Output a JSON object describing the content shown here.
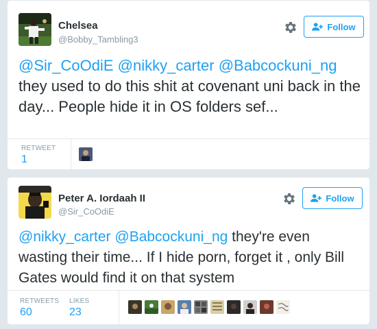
{
  "tweets": [
    {
      "name": "Chelsea",
      "handle": "@Bobby_Tambling3",
      "follow_label": "Follow",
      "text_mentions": [
        "@Sir_CoOdiE",
        "@nikky_carter",
        "@Babcockuni_ng"
      ],
      "text_body": " they used to do this shit at covenant uni back in the day... People hide it in OS folders sef...",
      "stats": {
        "retweet_label": "RETWEET",
        "retweet_count": "1"
      },
      "engager_avatars": [
        "retweeter-avatar"
      ]
    },
    {
      "name": "Peter A. Iordaah II",
      "handle": "@Sir_CoOdiE",
      "follow_label": "Follow",
      "text_mentions": [
        "@nikky_carter",
        "@Babcockuni_ng"
      ],
      "text_body": " they're even wasting their time... If I hide porn, forget it , only Bill Gates would find it on that system",
      "stats": {
        "retweets_label": "RETWEETS",
        "retweets_count": "60",
        "likes_label": "LIKES",
        "likes_count": "23"
      },
      "engager_avatars": [
        "liker-avatar-1",
        "liker-avatar-2",
        "liker-avatar-3",
        "liker-avatar-4",
        "liker-avatar-5",
        "liker-avatar-6",
        "liker-avatar-7",
        "liker-avatar-8",
        "liker-avatar-9",
        "liker-avatar-10"
      ]
    }
  ],
  "colors": {
    "link": "#1da1f2",
    "muted": "#8899a6",
    "text": "#292f33",
    "border": "#e1e8ed"
  },
  "icons": {
    "settings": "gear-icon",
    "follow": "add-user-icon"
  }
}
